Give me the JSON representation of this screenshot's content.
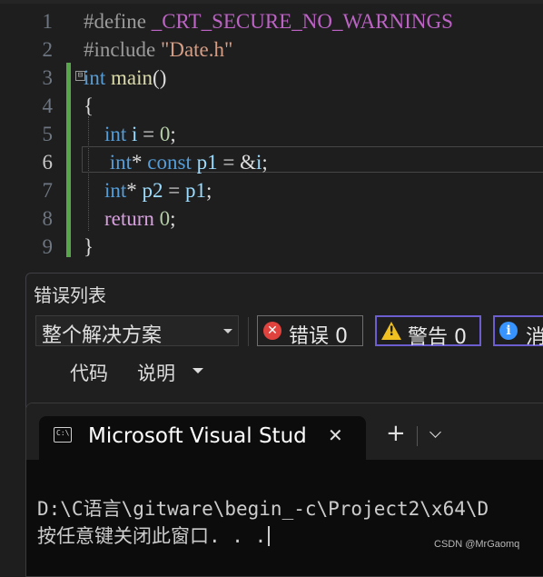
{
  "editor": {
    "lines": [
      {
        "n": "1",
        "tokens": [
          {
            "t": "#define",
            "c": "pp"
          },
          {
            "t": " ",
            "c": ""
          },
          {
            "t": "_CRT_SECURE_NO_WARNINGS",
            "c": "mac"
          }
        ]
      },
      {
        "n": "2",
        "tokens": [
          {
            "t": "#include",
            "c": "pp"
          },
          {
            "t": " ",
            "c": ""
          },
          {
            "t": "\"Date.h\"",
            "c": "str"
          }
        ]
      },
      {
        "n": "3",
        "tokens": [
          {
            "t": "int",
            "c": "kw"
          },
          {
            "t": " ",
            "c": ""
          },
          {
            "t": "main",
            "c": "fn"
          },
          {
            "t": "()",
            "c": ""
          }
        ]
      },
      {
        "n": "4",
        "tokens": [
          {
            "t": "{",
            "c": ""
          }
        ]
      },
      {
        "n": "5",
        "tokens": [
          {
            "t": "    ",
            "c": ""
          },
          {
            "t": "int",
            "c": "kw"
          },
          {
            "t": " ",
            "c": ""
          },
          {
            "t": "i",
            "c": "var"
          },
          {
            "t": " = ",
            "c": ""
          },
          {
            "t": "0",
            "c": "num"
          },
          {
            "t": ";",
            "c": ""
          }
        ]
      },
      {
        "n": "6",
        "tokens": [
          {
            "t": "     ",
            "c": ""
          },
          {
            "t": "int",
            "c": "kw"
          },
          {
            "t": "* ",
            "c": ""
          },
          {
            "t": "const",
            "c": "kw"
          },
          {
            "t": " ",
            "c": ""
          },
          {
            "t": "p1",
            "c": "var"
          },
          {
            "t": " = &",
            "c": ""
          },
          {
            "t": "i",
            "c": "var"
          },
          {
            "t": ";",
            "c": ""
          }
        ]
      },
      {
        "n": "7",
        "tokens": [
          {
            "t": "    ",
            "c": ""
          },
          {
            "t": "int",
            "c": "kw"
          },
          {
            "t": "* ",
            "c": ""
          },
          {
            "t": "p2",
            "c": "var"
          },
          {
            "t": " = ",
            "c": ""
          },
          {
            "t": "p1",
            "c": "var"
          },
          {
            "t": ";",
            "c": ""
          }
        ]
      },
      {
        "n": "8",
        "tokens": [
          {
            "t": "    ",
            "c": ""
          },
          {
            "t": "return",
            "c": "ctrl"
          },
          {
            "t": " ",
            "c": ""
          },
          {
            "t": "0",
            "c": "num"
          },
          {
            "t": ";",
            "c": ""
          }
        ]
      },
      {
        "n": "9",
        "tokens": [
          {
            "t": "}",
            "c": ""
          }
        ]
      }
    ],
    "active_line": "6",
    "fold_glyph": "⊟"
  },
  "error_list": {
    "title": "错误列表",
    "scope": "整个解决方案",
    "errors_label": "错误 0",
    "warnings_label": "警告 0",
    "messages_label": "消",
    "columns": [
      "代码",
      "说明"
    ],
    "colors": {
      "error": "#e0433e",
      "warning": "#f0c020",
      "info": "#3794ff",
      "active_filter_border": "#6c5ecf"
    }
  },
  "terminal": {
    "tab_title": "Microsoft Visual Stud",
    "tab_icon": "terminal-icon",
    "close_glyph": "✕",
    "new_tab_glyph": "+",
    "output_line1": "D:\\C语言\\gitware\\begin_-c\\Project2\\x64\\D",
    "output_line2": "按任意键关闭此窗口. . ."
  },
  "watermark": "CSDN @MrGaomq"
}
